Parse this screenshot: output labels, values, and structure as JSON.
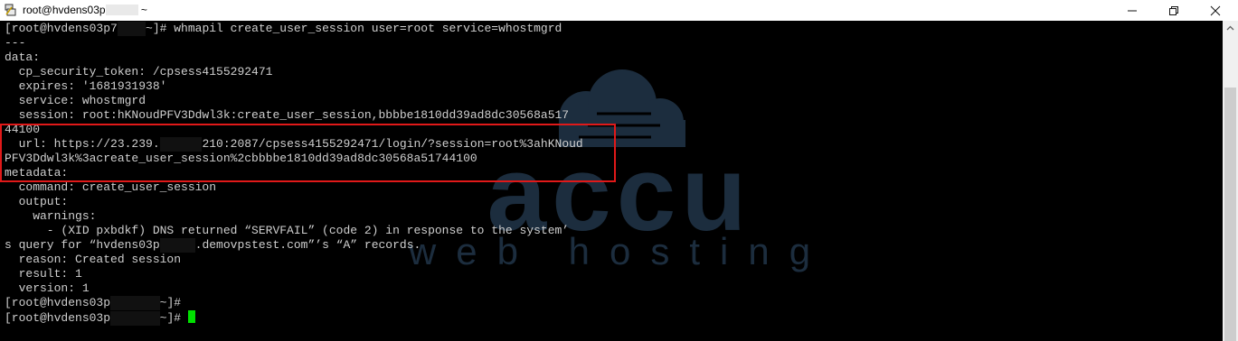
{
  "window": {
    "title_prefix": "root@hvdens03p",
    "title_suffix": " ~"
  },
  "terminal": {
    "lines": [
      {
        "pre": "[root@hvdens03p7",
        "redacted": "    ",
        "post": "~]# whmapil create_user_session user=root service=whostmgrd"
      },
      {
        "pre": "---"
      },
      {
        "pre": "data:"
      },
      {
        "pre": "  cp_security_token: /cpsess4155292471"
      },
      {
        "pre": "  expires: '1681931938'"
      },
      {
        "pre": "  service: whostmgrd"
      },
      {
        "pre": "  session: root:hKNoudPFV3Ddwl3k:create_user_session,bbbbe1810dd39ad8dc30568a517"
      },
      {
        "pre": "44100"
      },
      {
        "pre": "  url: https://23.239.",
        "redacted": "      ",
        "post": "210:2087/cpsess4155292471/login/?session=root%3ahKNoud"
      },
      {
        "pre": "PFV3Ddwl3k%3acreate_user_session%2cbbbbe1810dd39ad8dc30568a51744100"
      },
      {
        "pre": "metadata:"
      },
      {
        "pre": "  command: create_user_session"
      },
      {
        "pre": "  output:"
      },
      {
        "pre": "    warnings:"
      },
      {
        "pre": "      - (XID pxbdkf) DNS returned “SERVFAIL” (code 2) in response to the system’"
      },
      {
        "pre": "s query for “hvdens03p",
        "redacted": "     ",
        "post": ".demovpstest.com”’s “A” records."
      },
      {
        "pre": "  reason: Created session"
      },
      {
        "pre": "  result: 1"
      },
      {
        "pre": "  version: 1"
      },
      {
        "pre": "[root@hvdens03p",
        "redacted": "       ",
        "post": "~]#"
      },
      {
        "pre": "[root@hvdens03p",
        "redacted": "       ",
        "post": "~]# ",
        "cursor": true
      }
    ]
  },
  "watermark": {
    "word_large": "accu",
    "word_small": "web hosting",
    "color": "#1c2d3e"
  },
  "colors": {
    "highlight_box": "#e01919",
    "cursor": "#00e000",
    "text": "#cfcfcf"
  }
}
